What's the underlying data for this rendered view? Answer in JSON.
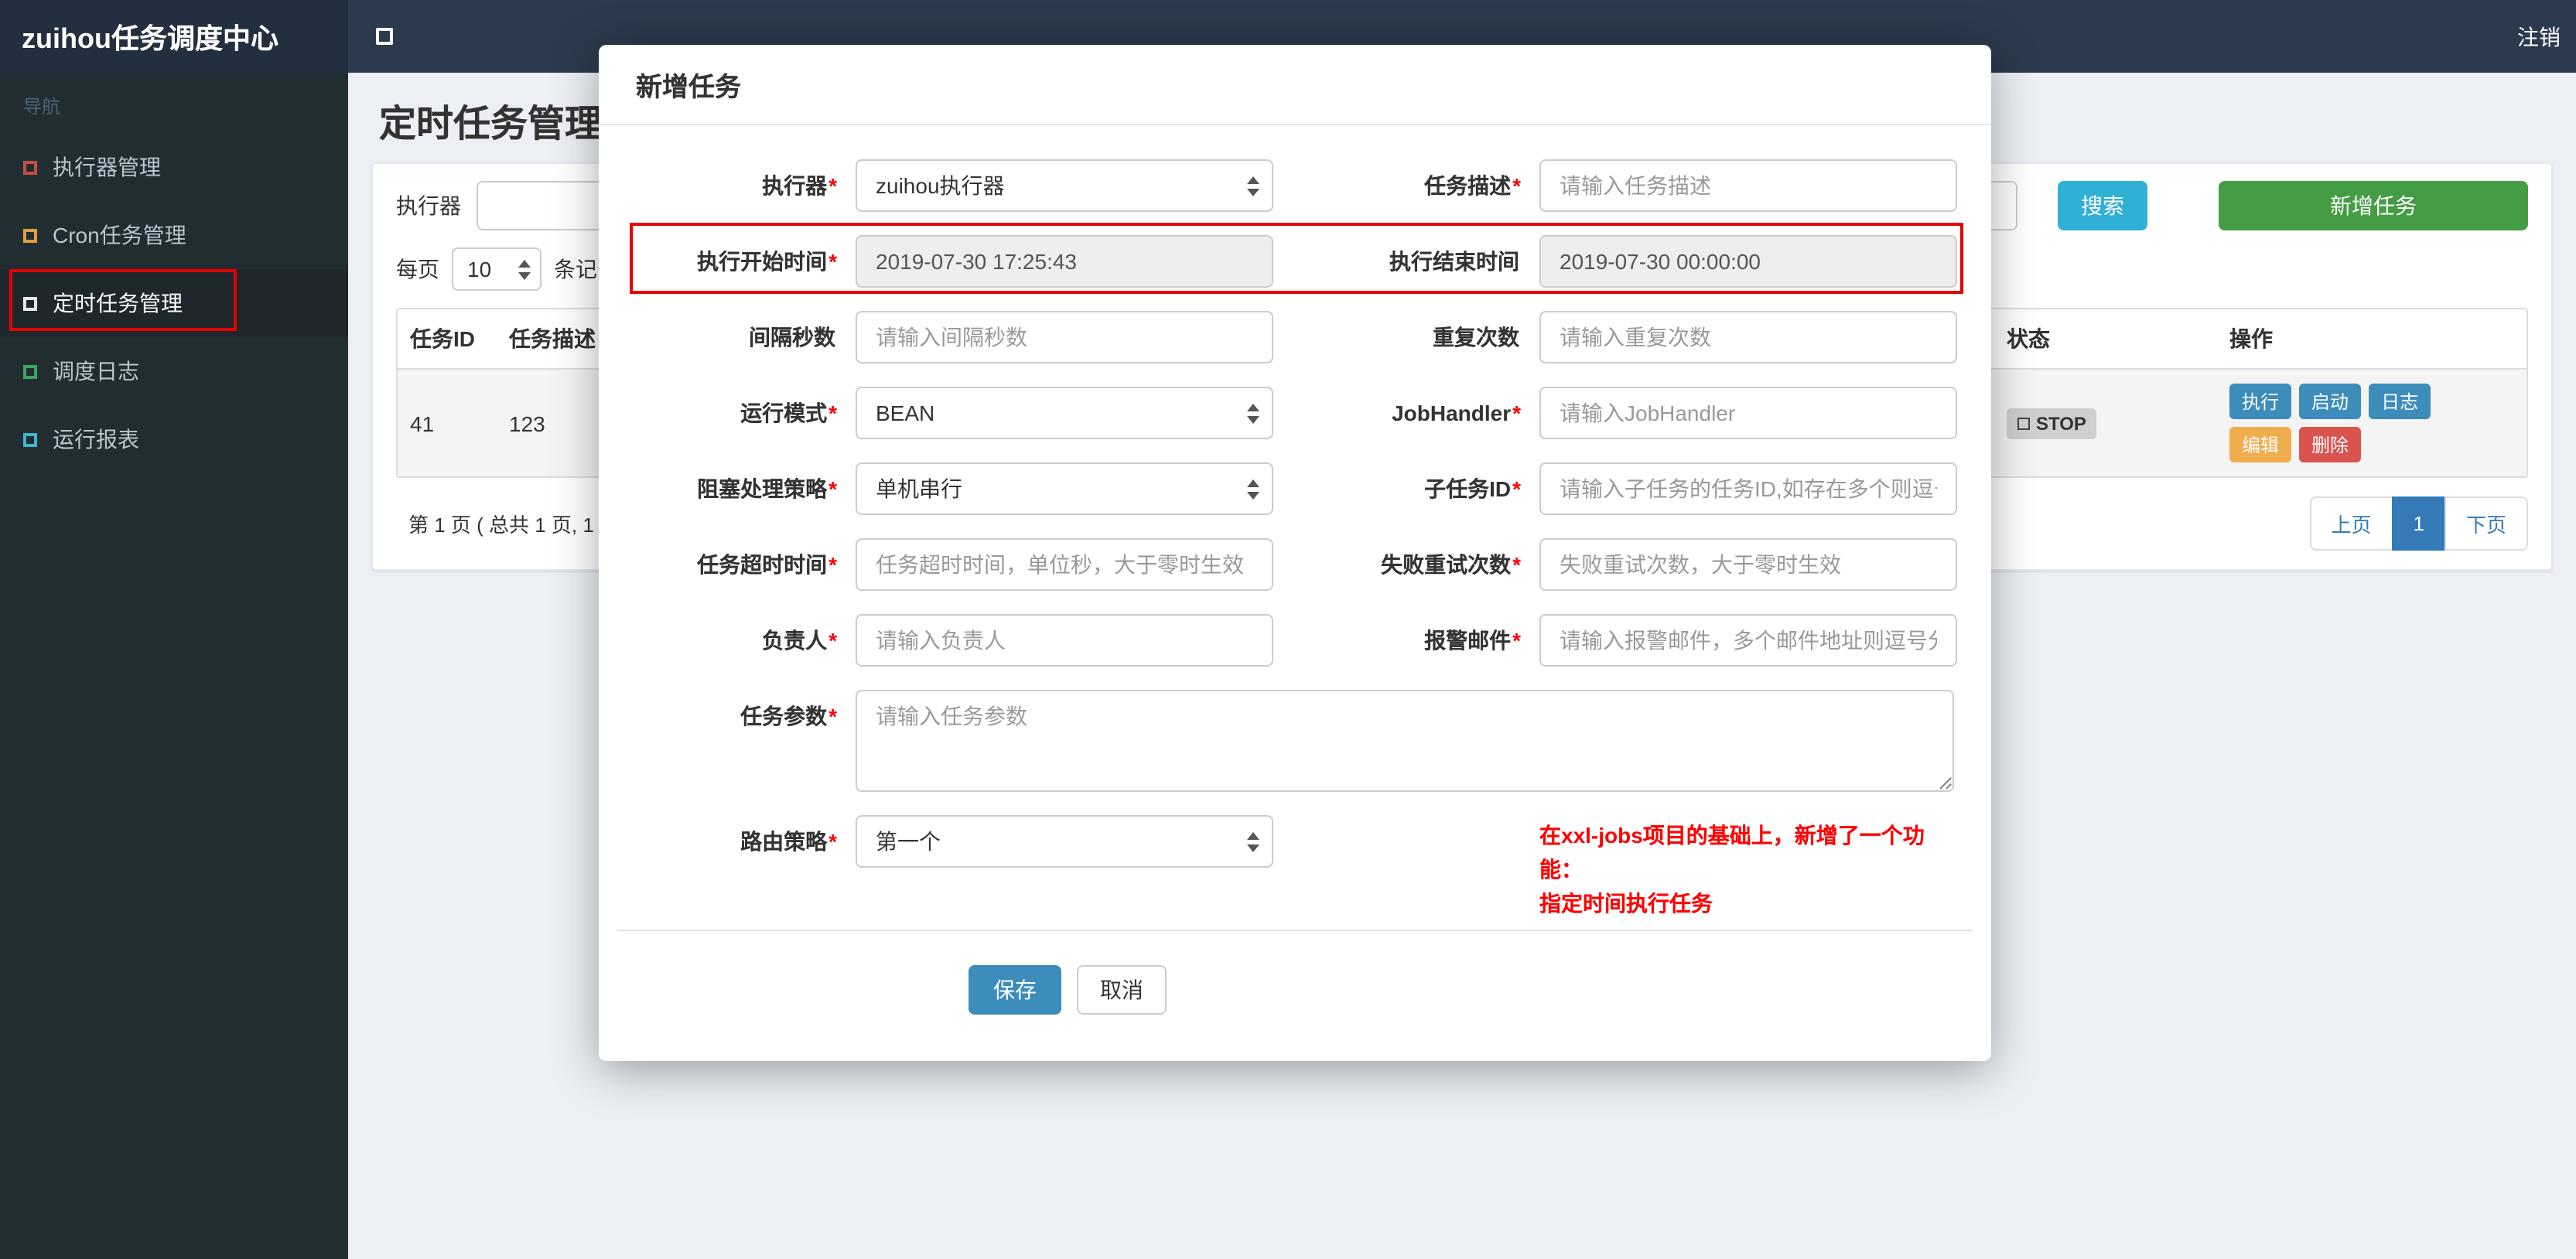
{
  "theme": {
    "accent_blue": "#3c8dbc",
    "search_teal": "#31b0d5",
    "add_green": "#449d44",
    "edit_orange": "#f0ad4e",
    "delete_red": "#d9534f",
    "annotation_red": "#e60000"
  },
  "navbar": {
    "brand": "zuihou任务调度中心",
    "logout": "注销"
  },
  "sidebar": {
    "header": "导航",
    "items": [
      {
        "label": "执行器管理",
        "icon": "square-outline-icon",
        "color": "#c34f44"
      },
      {
        "label": "Cron任务管理",
        "icon": "square-outline-icon",
        "color": "#e09e3e"
      },
      {
        "label": "定时任务管理",
        "icon": "square-outline-icon",
        "color": "#e8e8e8"
      },
      {
        "label": "调度日志",
        "icon": "square-outline-icon",
        "color": "#3fa55f"
      },
      {
        "label": "运行报表",
        "icon": "square-outline-icon",
        "color": "#3fb6c9"
      }
    ]
  },
  "page": {
    "title": "定时任务管理",
    "toolbar": {
      "executor_label": "执行器",
      "search": "搜索",
      "add_task": "新增任务"
    },
    "controls": {
      "per_page_label": "每页",
      "per_page_value": "10",
      "per_page_suffix": "条记录"
    },
    "table": {
      "col_task_id": "任务ID",
      "col_task_desc": "任务描述",
      "col_status": "状态",
      "col_actions": "操作",
      "row": {
        "task_id": "41",
        "task_desc": "123",
        "status": "STOP",
        "actions": {
          "run": "执行",
          "start": "启动",
          "log": "日志",
          "edit": "编辑",
          "delete": "删除"
        }
      }
    },
    "pagination": {
      "summary": "第 1 页 ( 总共 1 页, 1",
      "prev": "上页",
      "page1": "1",
      "next": "下页"
    }
  },
  "modal": {
    "title": "新增任务",
    "rows": [
      {
        "left": {
          "label": "执行器",
          "star": "*",
          "value": "zuihou执行器"
        },
        "right": {
          "label": "任务描述",
          "star": "*",
          "placeholder": "请输入任务描述"
        }
      },
      {
        "left": {
          "label": "执行开始时间",
          "star": "*",
          "value": "2019-07-30 17:25:43"
        },
        "right": {
          "label": "执行结束时间",
          "star": "",
          "value": "2019-07-30 00:00:00"
        }
      },
      {
        "left": {
          "label": "间隔秒数",
          "star": "",
          "placeholder": "请输入间隔秒数"
        },
        "right": {
          "label": "重复次数",
          "star": "",
          "placeholder": "请输入重复次数"
        }
      },
      {
        "left": {
          "label": "运行模式",
          "star": "*",
          "value": "BEAN"
        },
        "right": {
          "label": "JobHandler",
          "star": "*",
          "placeholder": "请输入JobHandler"
        }
      },
      {
        "left": {
          "label": "阻塞处理策略",
          "star": "*",
          "value": "单机串行"
        },
        "right": {
          "label": "子任务ID",
          "star": "*",
          "placeholder": "请输入子任务的任务ID,如存在多个则逗号分隔"
        }
      },
      {
        "left": {
          "label": "任务超时时间",
          "star": "*",
          "placeholder": "任务超时时间，单位秒，大于零时生效"
        },
        "right": {
          "label": "失败重试次数",
          "star": "*",
          "placeholder": "失败重试次数，大于零时生效"
        }
      },
      {
        "left": {
          "label": "负责人",
          "star": "*",
          "placeholder": "请输入负责人"
        },
        "right": {
          "label": "报警邮件",
          "star": "*",
          "placeholder": "请输入报警邮件，多个邮件地址则逗号分隔"
        }
      }
    ],
    "param": {
      "label": "任务参数",
      "star": "*",
      "placeholder": "请输入任务参数"
    },
    "route": {
      "label": "路由策略",
      "star": "*",
      "value": "第一个"
    },
    "note_line1": "在xxl-jobs项目的基础上，新增了一个功能：",
    "note_line2": "指定时间执行任务",
    "buttons": {
      "save": "保存",
      "cancel": "取消"
    }
  }
}
